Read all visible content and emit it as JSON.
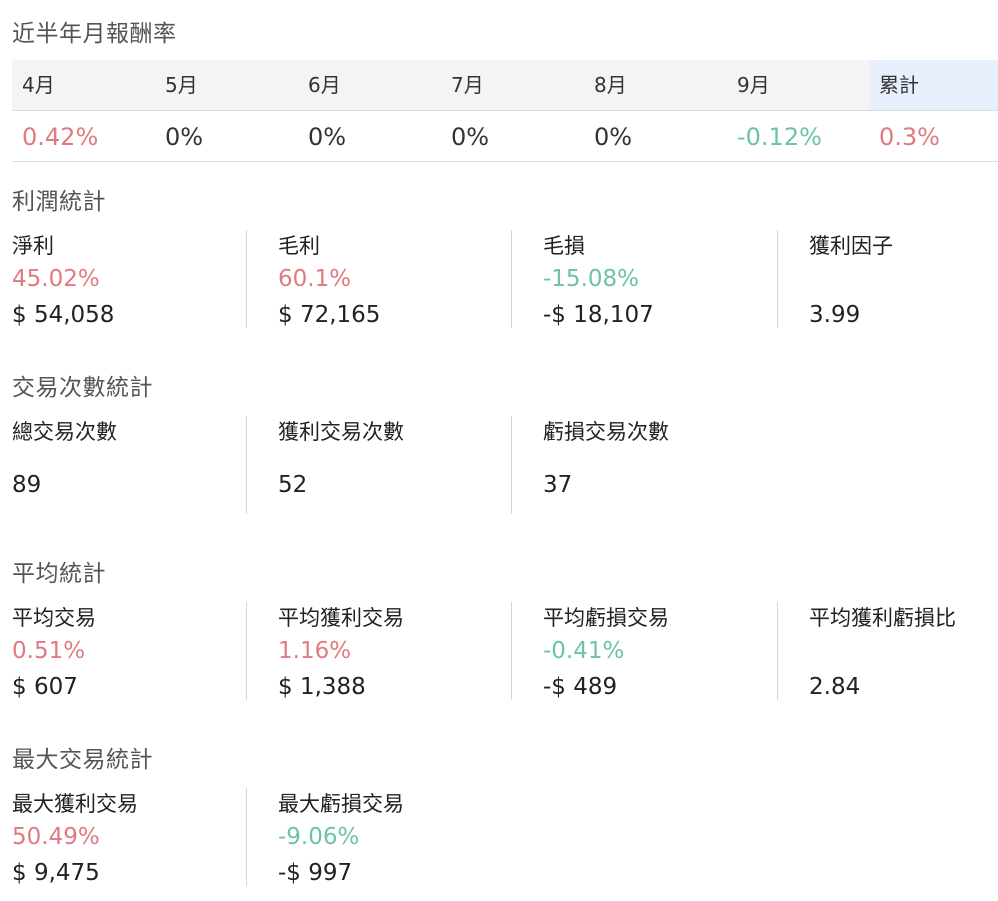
{
  "monthly": {
    "title": "近半年月報酬率",
    "headers": [
      "4月",
      "5月",
      "6月",
      "7月",
      "8月",
      "9月",
      "累計"
    ],
    "values": [
      "0.42%",
      "0%",
      "0%",
      "0%",
      "0%",
      "-0.12%",
      "0.3%"
    ]
  },
  "profit": {
    "title": "利潤統計",
    "items": [
      {
        "label": "淨利",
        "pct": "45.02%",
        "amount": "$ 54,058"
      },
      {
        "label": "毛利",
        "pct": "60.1%",
        "amount": "$ 72,165"
      },
      {
        "label": "毛損",
        "pct": "-15.08%",
        "amount": "-$ 18,107"
      },
      {
        "label": "獲利因子",
        "amount": "3.99"
      }
    ]
  },
  "count": {
    "title": "交易次數統計",
    "items": [
      {
        "label": "總交易次數",
        "value": "89"
      },
      {
        "label": "獲利交易次數",
        "value": "52"
      },
      {
        "label": "虧損交易次數",
        "value": "37"
      }
    ]
  },
  "average": {
    "title": "平均統計",
    "items": [
      {
        "label": "平均交易",
        "pct": "0.51%",
        "amount": "$ 607"
      },
      {
        "label": "平均獲利交易",
        "pct": "1.16%",
        "amount": "$ 1,388"
      },
      {
        "label": "平均虧損交易",
        "pct": "-0.41%",
        "amount": "-$ 489"
      },
      {
        "label": "平均獲利虧損比",
        "amount": "2.84"
      }
    ]
  },
  "max": {
    "title": "最大交易統計",
    "items": [
      {
        "label": "最大獲利交易",
        "pct": "50.49%",
        "amount": "$ 9,475"
      },
      {
        "label": "最大虧損交易",
        "pct": "-9.06%",
        "amount": "-$ 997"
      }
    ]
  },
  "colors": {
    "positive": "#e07a80",
    "negative": "#6cc4a4"
  }
}
